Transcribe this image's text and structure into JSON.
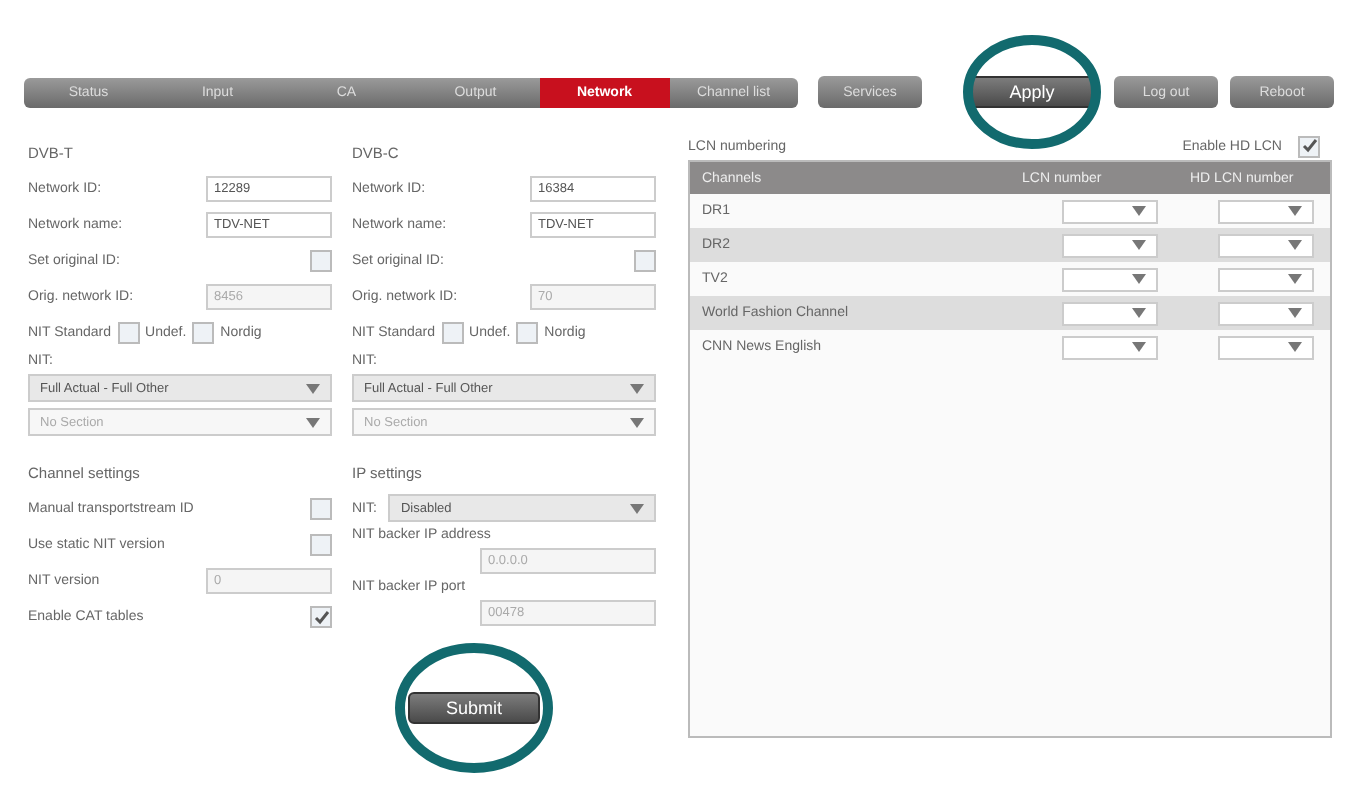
{
  "tabs": [
    {
      "label": "Status",
      "selected": false
    },
    {
      "label": "Input",
      "selected": false
    },
    {
      "label": "CA",
      "selected": false
    },
    {
      "label": "Output",
      "selected": false
    },
    {
      "label": "Network",
      "selected": true
    },
    {
      "label": "Channel list",
      "selected": false
    }
  ],
  "buttons": [
    {
      "label": "Services",
      "highlighted": false
    },
    {
      "label": "Apply",
      "highlighted": true
    },
    {
      "label": "Log out",
      "highlighted": false
    },
    {
      "label": "Reboot",
      "highlighted": false
    }
  ],
  "networks": [
    {
      "title": "DVB-T",
      "network_id_label": "Network ID:",
      "network_id": "12289",
      "network_name_label": "Network name:",
      "network_name": "TDV-NET",
      "set_original_id_label": "Set original ID:",
      "set_original_id": false,
      "orig_network_id_label": "Orig. network ID:",
      "orig_network_id": "8456",
      "nit_standard_label": "NIT Standard",
      "nit_standard": false,
      "undef_label": "Undef.",
      "undef": false,
      "nordig_label": "Nordig",
      "nit_label": "NIT:",
      "nit_select": "Full Actual - Full Other",
      "section_select": "No Section"
    },
    {
      "title": "DVB-C",
      "network_id_label": "Network ID:",
      "network_id": "16384",
      "network_name_label": "Network name:",
      "network_name": "TDV-NET",
      "set_original_id_label": "Set original ID:",
      "set_original_id": false,
      "orig_network_id_label": "Orig. network ID:",
      "orig_network_id": "70",
      "nit_standard_label": "NIT Standard",
      "nit_standard": false,
      "undef_label": "Undef.",
      "undef": false,
      "nordig_label": "Nordig",
      "nit_label": "NIT:",
      "nit_select": "Full Actual - Full Other",
      "section_select": "No Section"
    }
  ],
  "channel_settings": {
    "title": "Channel settings",
    "manual_ts_label": "Manual transportstream ID",
    "manual_ts": false,
    "static_nit_label": "Use static NIT version",
    "static_nit": false,
    "nit_version_label": "NIT version",
    "nit_version": "0",
    "cat_label": "Enable CAT tables",
    "cat": true
  },
  "ip_settings": {
    "title": "IP settings",
    "nit_label": "NIT:",
    "nit_select": "Disabled",
    "address_label": "NIT backer IP address",
    "address": "0.0.0.0",
    "port_label": "NIT backer IP port",
    "port": "00478"
  },
  "submit": {
    "label": "Submit",
    "highlighted": true
  },
  "lcn": {
    "title": "LCN numbering",
    "hd_label": "Enable HD LCN",
    "hd_enabled": true,
    "columns": [
      "Channels",
      "LCN number",
      "HD LCN number"
    ],
    "rows": [
      {
        "name": "DR1"
      },
      {
        "name": "DR2"
      },
      {
        "name": "TV2"
      },
      {
        "name": "World Fashion Channel"
      },
      {
        "name": "CNN News English"
      }
    ]
  }
}
